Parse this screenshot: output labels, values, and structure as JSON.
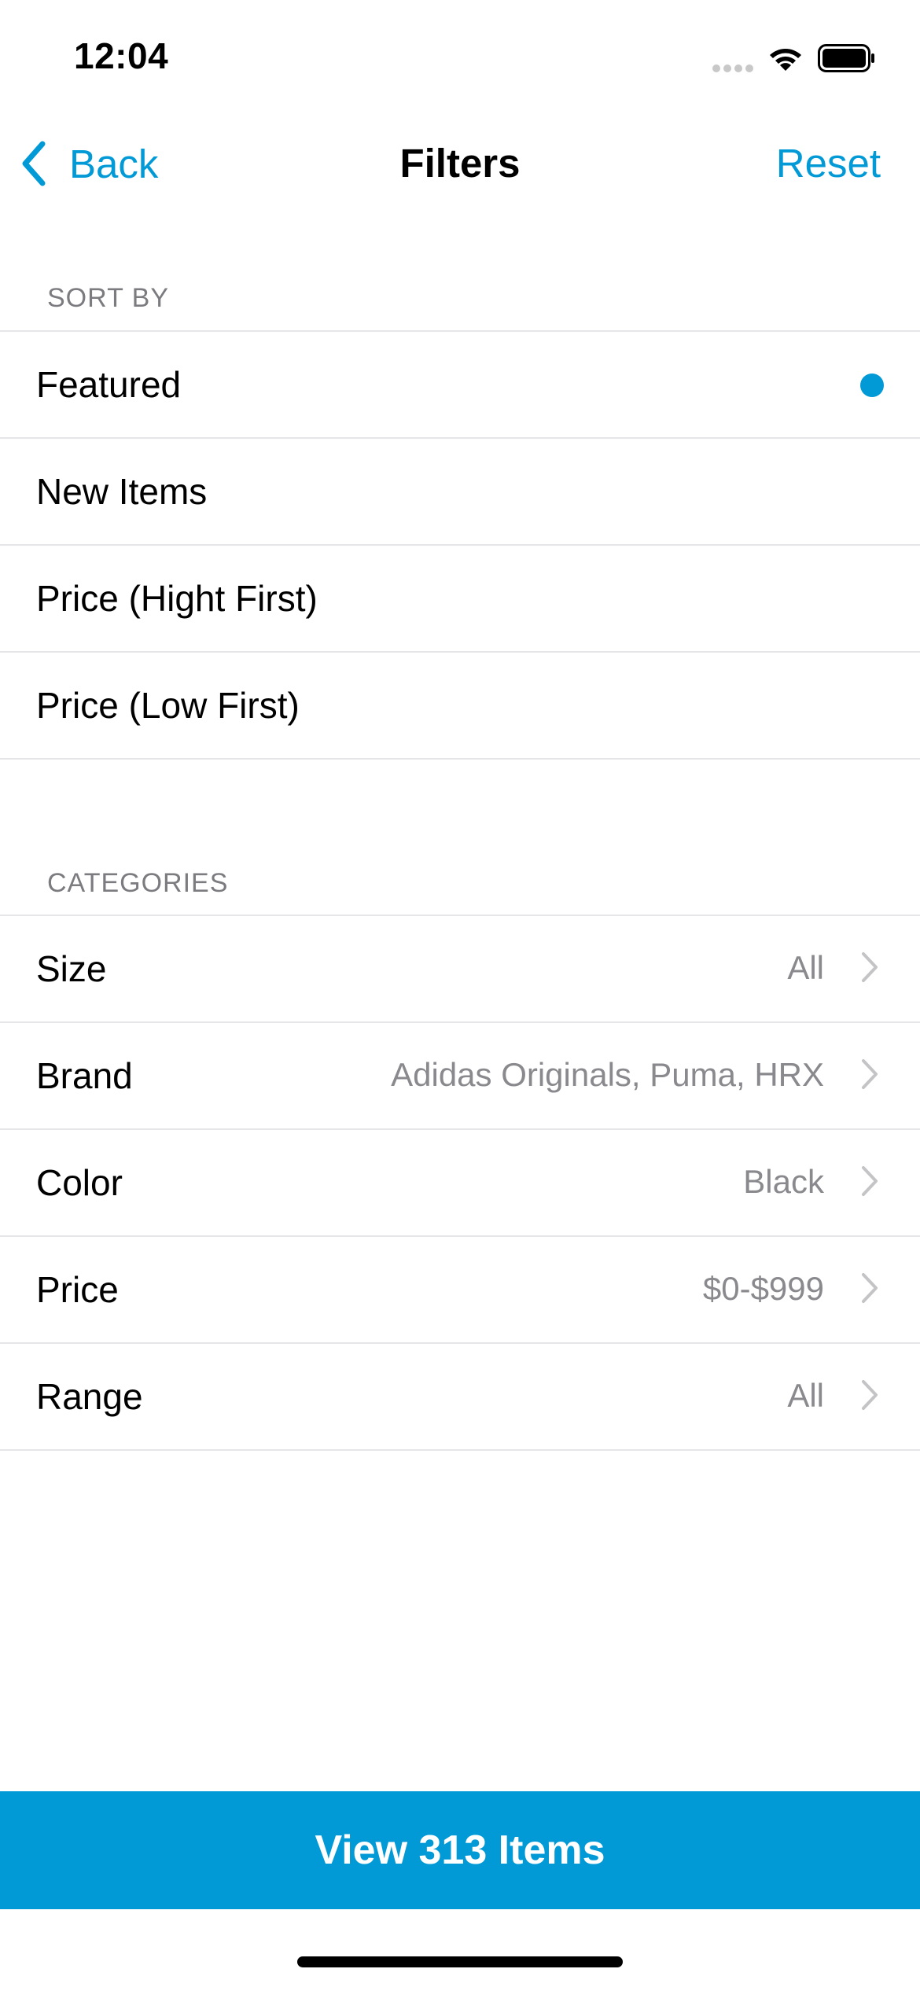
{
  "status_bar": {
    "time": "12:04"
  },
  "nav": {
    "back_label": "Back",
    "title": "Filters",
    "reset_label": "Reset"
  },
  "sort_by": {
    "header": "SORT BY",
    "options": [
      {
        "label": "Featured",
        "selected": true
      },
      {
        "label": "New Items",
        "selected": false
      },
      {
        "label": "Price (Hight First)",
        "selected": false
      },
      {
        "label": "Price (Low First)",
        "selected": false
      }
    ]
  },
  "categories": {
    "header": "CATEGORIES",
    "items": [
      {
        "label": "Size",
        "value": "All"
      },
      {
        "label": "Brand",
        "value": "Adidas Originals, Puma, HRX"
      },
      {
        "label": "Color",
        "value": "Black"
      },
      {
        "label": "Price",
        "value": "$0-$999"
      },
      {
        "label": "Range",
        "value": "All"
      }
    ]
  },
  "footer": {
    "view_button_label": "View 313 Items"
  },
  "colors": {
    "accent": "#019ad6",
    "secondary_text": "#8a8a8e",
    "separator": "#e6e6e8"
  },
  "icons": [
    "chevron-left-icon",
    "chevron-right-icon",
    "wifi-icon",
    "battery-icon",
    "cellular-signal-icon",
    "selected-dot-icon"
  ]
}
